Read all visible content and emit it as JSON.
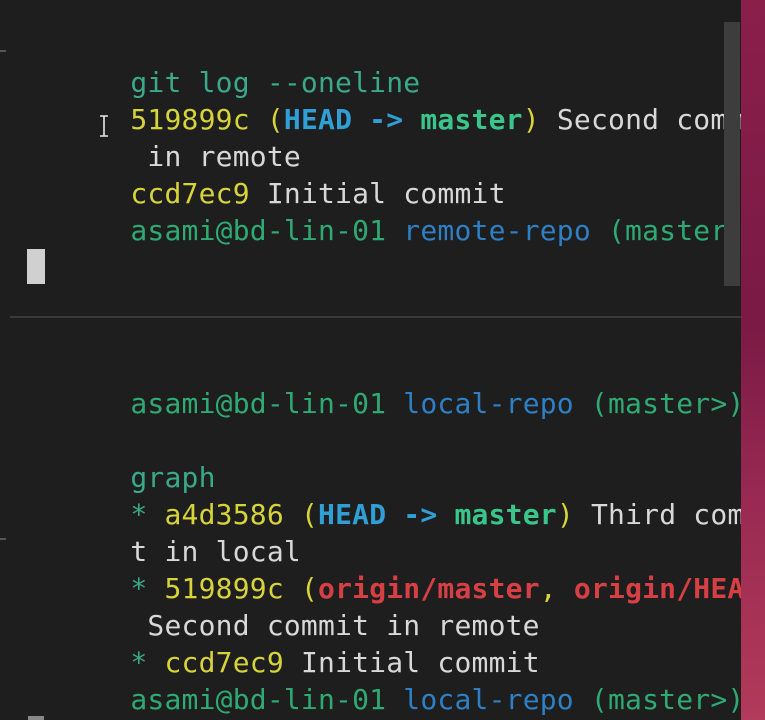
{
  "colors": {
    "background": "#1e1e1e",
    "command": "#3aa98a",
    "prompt_user": "#2faa73",
    "hash": "#d7d33a",
    "head": "#2f9fd6",
    "branch": "#3ac58a",
    "message": "#d8d8d8",
    "directory": "#2e7fc4",
    "dollar": "#c554b8",
    "origin": "#d64045",
    "desktop": "#8a1f4a"
  },
  "top_pane": {
    "command": "git log --oneline",
    "commit1": {
      "hash": "519899c",
      "open": " (",
      "head": "HEAD -> ",
      "branch": "master",
      "close": ")",
      "message_part1": " Second commit",
      "message_part2": " in remote"
    },
    "commit2": {
      "hash": "ccd7ec9",
      "message": " Initial commit"
    },
    "prompt": {
      "user_host": "asami@bd-lin-01",
      "dir": " remote-repo",
      "branch": " (master)",
      "dollar": " $"
    }
  },
  "bottom_pane": {
    "prompt1": {
      "user_host": "asami@bd-lin-01",
      "dir": " local-repo",
      "branch": " (master>)",
      "dollar": " $"
    },
    "graph_label": "graph",
    "commit1": {
      "star": "* ",
      "hash": "a4d3586",
      "open": " (",
      "head": "HEAD -> ",
      "branch": "master",
      "close": ")",
      "message_part1": " Third commi",
      "message_part2": "t in local"
    },
    "commit2": {
      "star": "* ",
      "hash": "519899c",
      "open": " (",
      "origin_master": "origin/master",
      "comma": ", ",
      "origin_head": "origin/HEAD",
      "close": ")",
      "message": " Second commit in remote"
    },
    "commit3": {
      "star": "* ",
      "hash": "ccd7ec9",
      "message": " Initial commit"
    },
    "prompt2": {
      "user_host": "asami@bd-lin-01",
      "dir": " local-repo",
      "branch": " (master>)",
      "dollar": " $"
    }
  }
}
